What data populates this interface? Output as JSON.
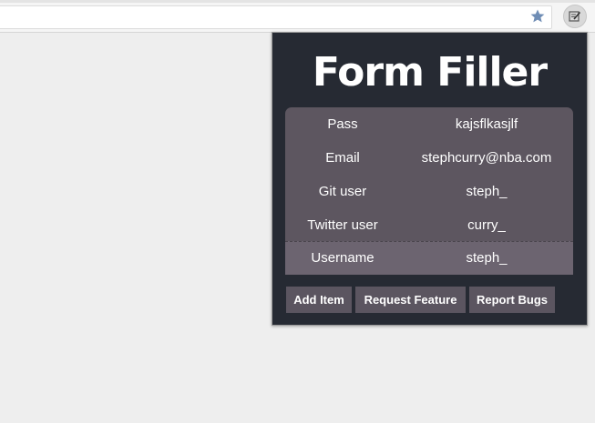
{
  "browser": {
    "bookmark_icon": "star-icon",
    "extension_icon": "form-filler-extension-icon"
  },
  "popup": {
    "title": "Form Filler",
    "rows": [
      {
        "key": "Pass",
        "value": "kajsflkasjlf"
      },
      {
        "key": "Email",
        "value": "stephcurry@nba.com"
      },
      {
        "key": "Git user",
        "value": "steph_"
      },
      {
        "key": "Twitter user",
        "value": "curry_"
      },
      {
        "key": "Username",
        "value": "steph_",
        "selected": true
      }
    ],
    "buttons": {
      "add_item": "Add Item",
      "request_feature": "Request Feature",
      "report_bugs": "Report Bugs"
    },
    "colors": {
      "background": "#262a33",
      "table": "#5d5660",
      "selected_row": "#6c6470",
      "button": "#5b5560",
      "text": "#ffffff"
    }
  }
}
